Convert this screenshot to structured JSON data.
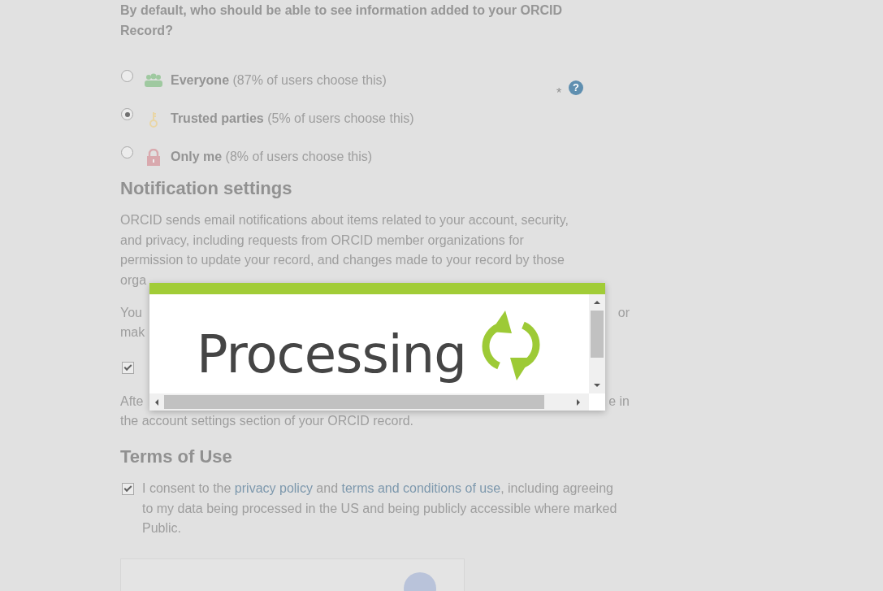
{
  "visibility": {
    "question": "By default, who should be able to see information added to your ORCID Record?",
    "required_mark": "*",
    "help_icon": "?",
    "options": [
      {
        "kind": "everyone",
        "label": "Everyone",
        "note": "(87% of users choose this)",
        "selected": false
      },
      {
        "kind": "trusted",
        "label": "Trusted parties",
        "note": "(5% of users choose this)",
        "selected": true
      },
      {
        "kind": "private",
        "label": "Only me",
        "note": "(8% of users choose this)",
        "selected": false
      }
    ]
  },
  "notifications": {
    "heading": "Notification settings",
    "intro_lines": [
      "ORCID sends email notifications about items related to your account, security,",
      "and privacy, including requests from ORCID member organizations for",
      "permission to update your record, and changes made to your record by those",
      "orga"
    ],
    "partial_lines": [
      {
        "left": "You",
        "right": "or"
      },
      {
        "left": "mak"
      }
    ],
    "checkbox": {
      "checked": true
    },
    "after_lines": [
      {
        "left": "Afte",
        "right": "e in"
      }
    ],
    "after_last": "the account settings section of your ORCID record."
  },
  "terms": {
    "heading": "Terms of Use",
    "consent": {
      "checked": true,
      "parts": [
        {
          "text": "I consent to the "
        },
        {
          "text": "privacy policy",
          "link": true
        },
        {
          "text": " and "
        },
        {
          "text": "terms and conditions of use",
          "link": true
        },
        {
          "text": ", including agreeing to my data being processed in the US and being publicly accessible where marked Public."
        }
      ]
    }
  },
  "modal": {
    "title": "Processing"
  }
}
